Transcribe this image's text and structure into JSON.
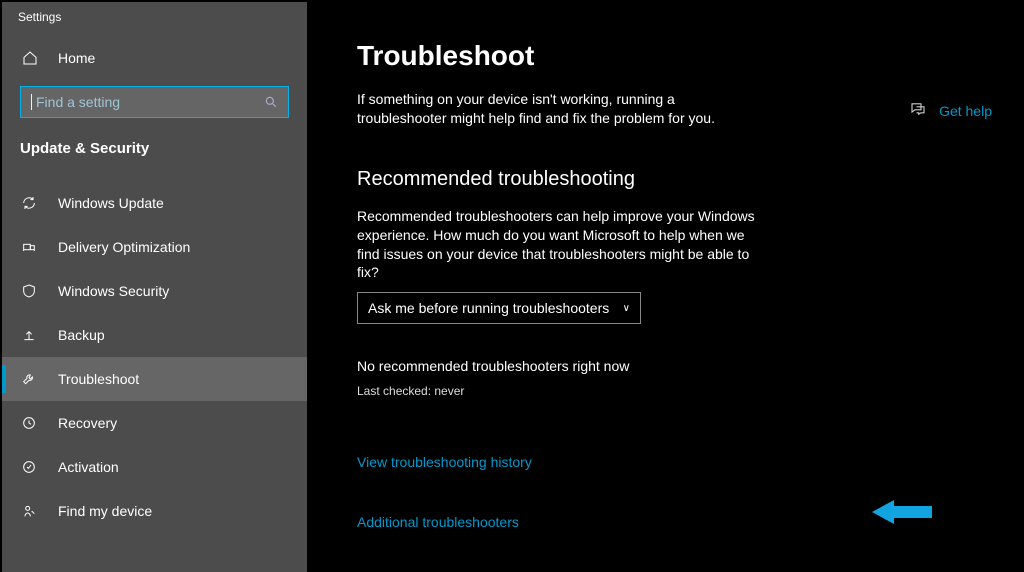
{
  "app": {
    "title": "Settings"
  },
  "sidebar": {
    "home": "Home",
    "search_placeholder": "Find a setting",
    "section": "Update & Security",
    "items": [
      {
        "label": "Windows Update"
      },
      {
        "label": "Delivery Optimization"
      },
      {
        "label": "Windows Security"
      },
      {
        "label": "Backup"
      },
      {
        "label": "Troubleshoot"
      },
      {
        "label": "Recovery"
      },
      {
        "label": "Activation"
      },
      {
        "label": "Find my device"
      }
    ]
  },
  "main": {
    "title": "Troubleshoot",
    "description": "If something on your device isn't working, running a troubleshooter might help find and fix the problem for you.",
    "recommended_heading": "Recommended troubleshooting",
    "recommended_description": "Recommended troubleshooters can help improve your Windows experience. How much do you want Microsoft to help when we find issues on your device that troubleshooters might be able to fix?",
    "dropdown_value": "Ask me before running troubleshooters",
    "status": "No recommended troubleshooters right now",
    "last_checked": "Last checked: never",
    "link_history": "View troubleshooting history",
    "link_additional": "Additional troubleshooters",
    "help": "Get help"
  }
}
